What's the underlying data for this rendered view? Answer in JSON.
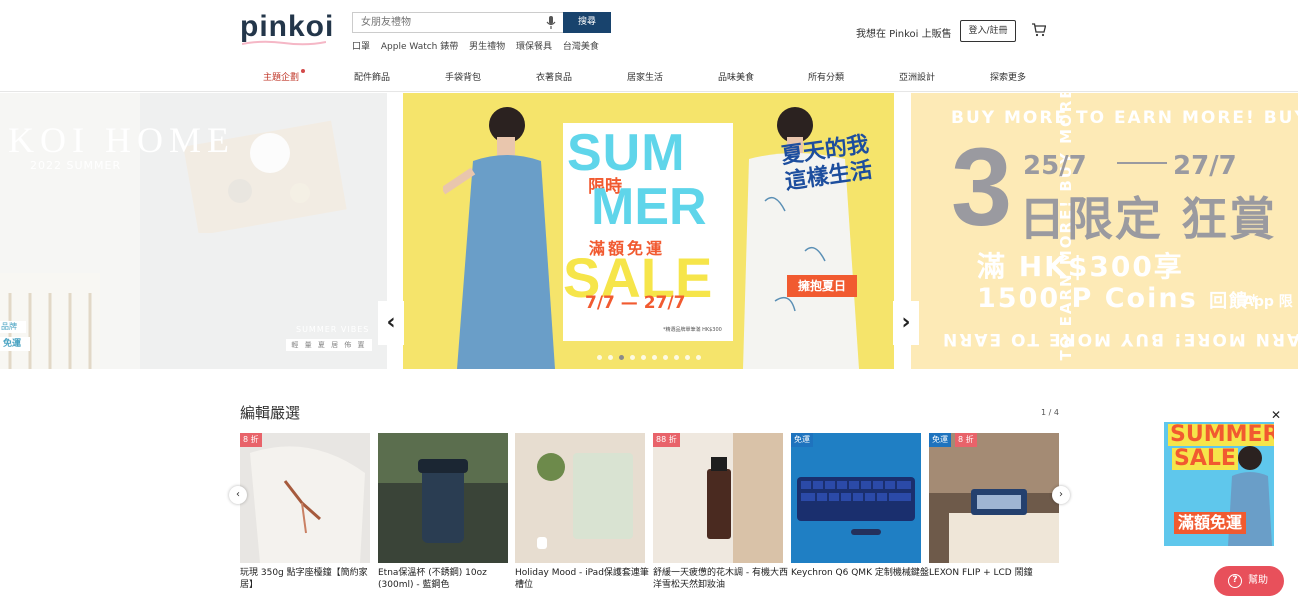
{
  "header": {
    "logo": "pinkoi",
    "search_placeholder": "女朋友禮物",
    "search_button": "搜尋",
    "quick_links": [
      "口罩",
      "Apple Watch 錶帶",
      "男生禮物",
      "環保餐具",
      "台灣美食"
    ],
    "seller_link": "我想在 Pinkoi 上販售",
    "login_button": "登入/註冊"
  },
  "nav": {
    "items": [
      "主題企劃",
      "配件飾品",
      "手袋背包",
      "衣著良品",
      "居家生活",
      "品味美食",
      "所有分類",
      "亞洲設計",
      "探索更多"
    ]
  },
  "banner": {
    "left": {
      "title": "KOI HOME",
      "subtitle": "2022 SUMMER",
      "vibes": "SUMMER VIBES",
      "vibes_sub": "輕 量 夏 居 佈 置",
      "tag1": "品牌",
      "tag2": "免運"
    },
    "main": {
      "limited": "限時",
      "sum": "SUM",
      "mer": "MER",
      "free": "滿額免運",
      "sale": "SALE",
      "dates": "7/7 — 27/7",
      "note": "*精選品牌單筆滿 HK$300",
      "summer_cn": "夏天的我\n這樣生活",
      "embrace": "擁抱夏日"
    },
    "right": {
      "repeat": "BUY MORE TO EARN MORE! BUY MORE TO EARN",
      "big": "3",
      "date_start": "25/7",
      "date_end": "27/7",
      "rush": "日限定 狂賞",
      "hk": "滿 HK$300享",
      "coins": "1500 P Coins",
      "coins_suffix": "回饋*",
      "app": "App 限"
    },
    "active_dot": 2,
    "dot_count": 10
  },
  "editors": {
    "title": "編輯嚴選",
    "pager": "1 / 4",
    "products": [
      {
        "name": "玩現 350g 點字座檯鐘【簡約家居】",
        "badges": [
          {
            "text": "8 折",
            "color": "red"
          }
        ]
      },
      {
        "name": "Etna保溫杯 (不銹鋼) 10oz (300ml) - 藍鋼色",
        "badges": []
      },
      {
        "name": "Holiday Mood - iPad保護套連筆槽位",
        "badges": []
      },
      {
        "name": "舒緩一天疲憊的花木調 - 有機大西洋雪松天然卸妝油",
        "badges": [
          {
            "text": "88 折",
            "color": "red"
          }
        ]
      },
      {
        "name": "Keychron Q6 QMK 定制機械鍵盤",
        "badges": [
          {
            "text": "免運",
            "color": "blue"
          }
        ]
      },
      {
        "name": "LEXON FLIP + LCD 鬧鐘",
        "badges": [
          {
            "text": "免運",
            "color": "blue"
          },
          {
            "text": "8 折",
            "color": "red"
          }
        ]
      }
    ]
  },
  "promo": {
    "summer": "SUMMER",
    "sale": "SALE",
    "free": "滿額免運"
  },
  "help_button": "幫助",
  "colors": {
    "brand_navy": "#18436d",
    "accent_red": "#e8505b",
    "banner_yellow": "#f5e46b",
    "banner_cyan": "#5fd5ea"
  }
}
